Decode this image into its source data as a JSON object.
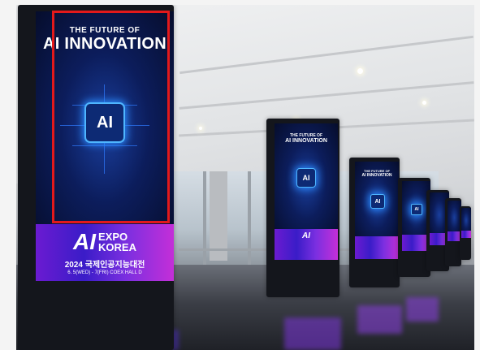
{
  "signage": {
    "title_line1": "THE FUTURE OF",
    "title_line2": "AI INNOVATION",
    "chip_label": "AI",
    "expo_logo_a": "AI",
    "expo_logo_word1": "EXPO",
    "expo_logo_word2": "KOREA",
    "korean_line": "2024 국제인공지능대전",
    "date_venue": "6. 5(WED) - 7(FRI) COEX HALL D"
  },
  "annotation": {
    "highlight_color": "#e3191b"
  },
  "colors": {
    "panel_blue": "#0c1d5c",
    "panel_purple": "#6b1bd1",
    "chip_glow": "#2b8bff"
  }
}
